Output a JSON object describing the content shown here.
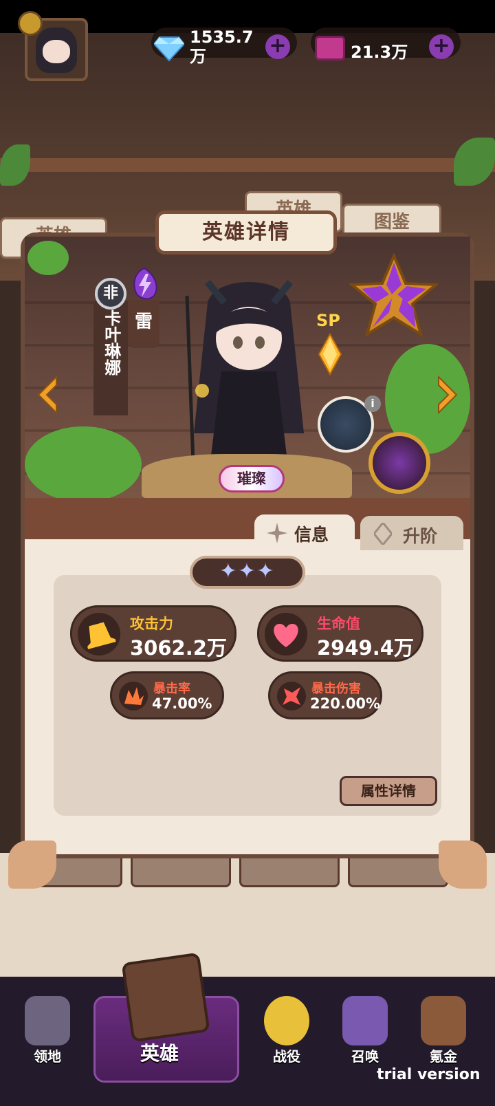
{
  "header": {
    "gems_value": "1535.7万",
    "tickets_value": "21.3万"
  },
  "background_tabs": [
    "英雄",
    "英雄",
    "图鉴"
  ],
  "panel": {
    "title": "英雄详情"
  },
  "hero": {
    "rarity": "非",
    "name": "卡叶琳娜",
    "element": "雷",
    "grade_label": "SP",
    "quality_badge": "璀璨",
    "star_count": 3,
    "skill_info_icon": "i"
  },
  "tabs": [
    {
      "label": "信息",
      "active": true
    },
    {
      "label": "升阶",
      "active": false
    }
  ],
  "stats": {
    "attack_label": "攻击力",
    "attack_value": "3062.2万",
    "hp_label": "生命值",
    "hp_value": "2949.4万",
    "crit_rate_label": "暴击率",
    "crit_rate_value": "47.00%",
    "crit_dmg_label": "暴击伤害",
    "crit_dmg_value": "220.00%"
  },
  "attr_button": "属性详情",
  "nav": [
    {
      "label": "领地",
      "icon": "castle-icon"
    },
    {
      "label": "英雄",
      "icon": "book-icon",
      "active": true
    },
    {
      "label": "战役",
      "icon": "chick-knight-icon"
    },
    {
      "label": "召唤",
      "icon": "summon-book-icon"
    },
    {
      "label": "氪金",
      "icon": "treasure-chest-icon"
    }
  ],
  "watermark": "trial version",
  "colors": {
    "panel_border": "#6b4a3a",
    "attack_label": "#ffc233",
    "hp_label": "#ff4a6a",
    "crit_label": "#ff6a4a",
    "nav_active": "#6a2c7e",
    "plus_button": "#8a3db0"
  }
}
